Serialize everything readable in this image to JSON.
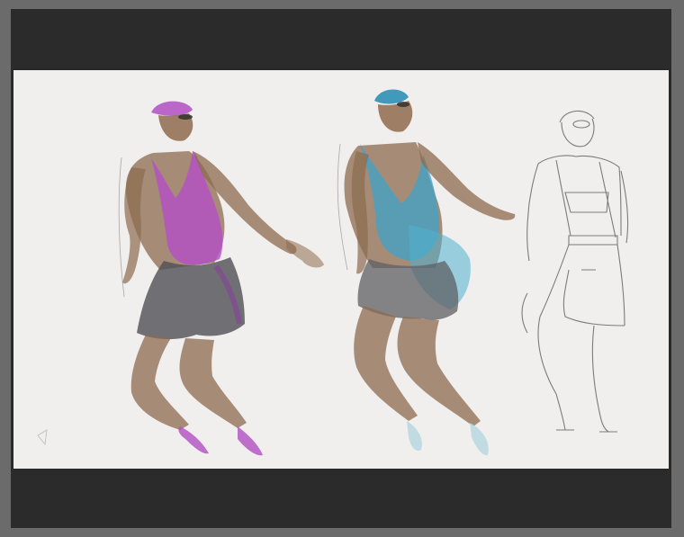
{
  "artwork": {
    "figures": [
      {
        "id": "figure-left",
        "accent_color": "#b44fc6",
        "skirt_color": "#4f4f55"
      },
      {
        "id": "figure-middle",
        "accent_color": "#3fa3c9",
        "skirt_color": "#5d5f63"
      },
      {
        "id": "figure-right",
        "accent_color": "#777777",
        "skirt_color": "#777777"
      }
    ],
    "colors": {
      "background_outer": "#6b6b6b",
      "mat": "#2b2b2b",
      "paper": "#f1efee",
      "skin": "#8c6b4f"
    }
  }
}
